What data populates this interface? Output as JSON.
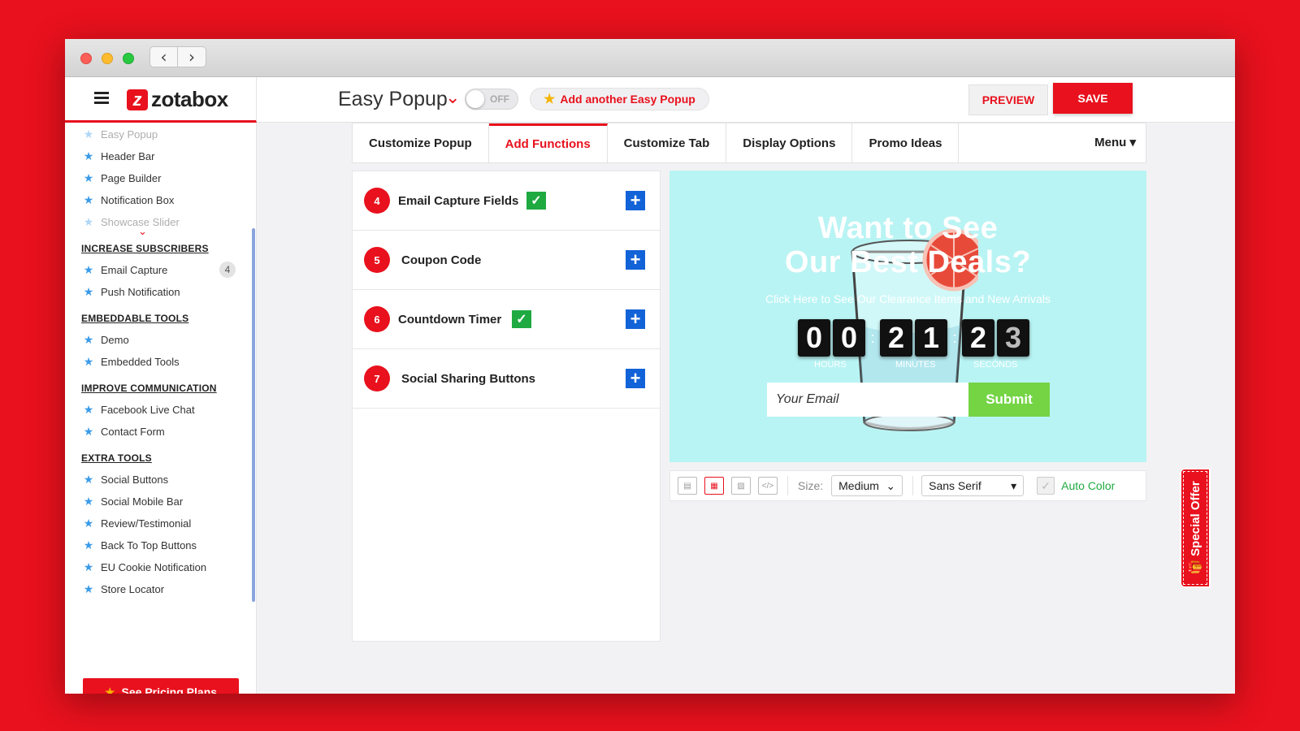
{
  "appbar": {
    "logo_text": "zotabox",
    "title": "Easy Popup",
    "toggle_label": "OFF",
    "add_another": "Add another Easy Popup",
    "preview": "PREVIEW",
    "save": "SAVE"
  },
  "sidebar": {
    "top_items": [
      "Easy Popup",
      "Header Bar",
      "Page Builder",
      "Notification Box",
      "Showcase Slider"
    ],
    "section_subscribers": "INCREASE SUBSCRIBERS",
    "subscriber_items": [
      "Email Capture",
      "Push Notification"
    ],
    "email_capture_badge": "4",
    "section_embeddable": "EMBEDDABLE TOOLS",
    "embeddable_items": [
      "Demo",
      "Embedded Tools"
    ],
    "section_communication": "IMPROVE COMMUNICATION",
    "communication_items": [
      "Facebook Live Chat",
      "Contact Form"
    ],
    "section_extra": "EXTRA TOOLS",
    "extra_items": [
      "Social Buttons",
      "Social Mobile Bar",
      "Review/Testimonial",
      "Back To Top Buttons",
      "EU Cookie Notification",
      "Store Locator"
    ],
    "pricing_button": "See Pricing Plans"
  },
  "tabs": [
    "Customize Popup",
    "Add Functions",
    "Customize Tab",
    "Display Options",
    "Promo Ideas"
  ],
  "tab_menu": "Menu",
  "functions": [
    {
      "num": "4",
      "label": "Email Capture Fields",
      "checked": true
    },
    {
      "num": "5",
      "label": "Coupon Code",
      "checked": false
    },
    {
      "num": "6",
      "label": "Countdown Timer",
      "checked": true
    },
    {
      "num": "7",
      "label": "Social Sharing Buttons",
      "checked": false
    }
  ],
  "popup": {
    "title_line1": "Want to See",
    "title_line2": "Our Best Deals?",
    "subtitle": "Click Here to See Our Clearance Items and New Arrivals",
    "digits": [
      "0",
      "0",
      "2",
      "1",
      "2",
      "3"
    ],
    "label_hours": "HOURS",
    "label_minutes": "MINUTES",
    "label_seconds": "SECONDS",
    "email_placeholder": "Your Email",
    "submit": "Submit",
    "background_color": "#b9f4f4",
    "submit_color": "#74d444"
  },
  "toolbar": {
    "size_label": "Size:",
    "size_value": "Medium",
    "font_value": "Sans Serif",
    "auto_color": "Auto Color"
  },
  "special_offer": "Special Offer",
  "colors": {
    "brand_red": "#e8111d",
    "star_blue": "#3a9be8",
    "check_green": "#1faa41",
    "plus_blue": "#1262d8"
  }
}
